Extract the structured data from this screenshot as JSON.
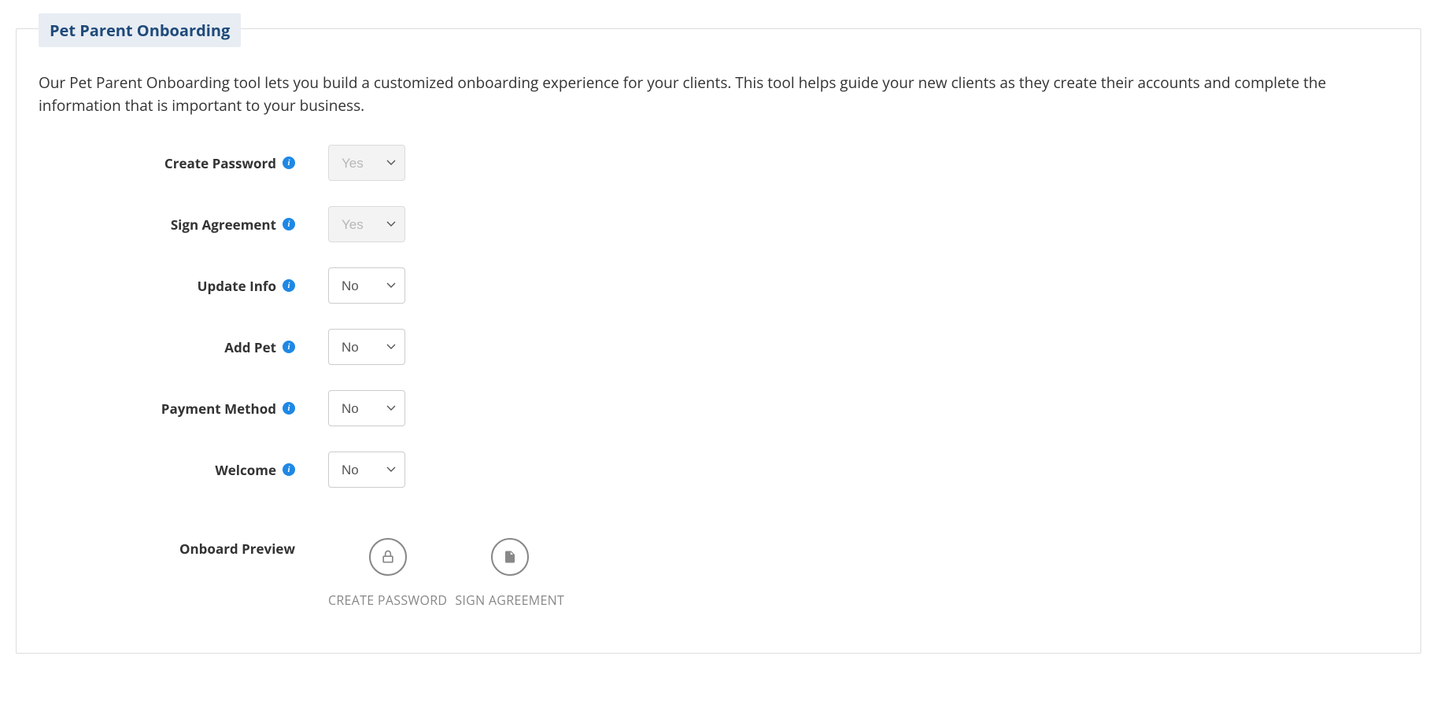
{
  "panel": {
    "title": "Pet Parent Onboarding",
    "description": "Our Pet Parent Onboarding tool lets you build a customized onboarding experience for your clients. This tool helps guide your new clients as they create their accounts and complete the information that is important to your business."
  },
  "fields": {
    "create_password": {
      "label": "Create Password",
      "value": "Yes",
      "disabled": true
    },
    "sign_agreement": {
      "label": "Sign Agreement",
      "value": "Yes",
      "disabled": true
    },
    "update_info": {
      "label": "Update Info",
      "value": "No",
      "disabled": false
    },
    "add_pet": {
      "label": "Add Pet",
      "value": "No",
      "disabled": false
    },
    "payment_method": {
      "label": "Payment Method",
      "value": "No",
      "disabled": false
    },
    "welcome": {
      "label": "Welcome",
      "value": "No",
      "disabled": false
    }
  },
  "preview": {
    "label": "Onboard Preview",
    "items": [
      {
        "icon": "lock",
        "label": "CREATE PASSWORD"
      },
      {
        "icon": "document",
        "label": "SIGN AGREEMENT"
      }
    ]
  },
  "options": {
    "yes": "Yes",
    "no": "No"
  }
}
